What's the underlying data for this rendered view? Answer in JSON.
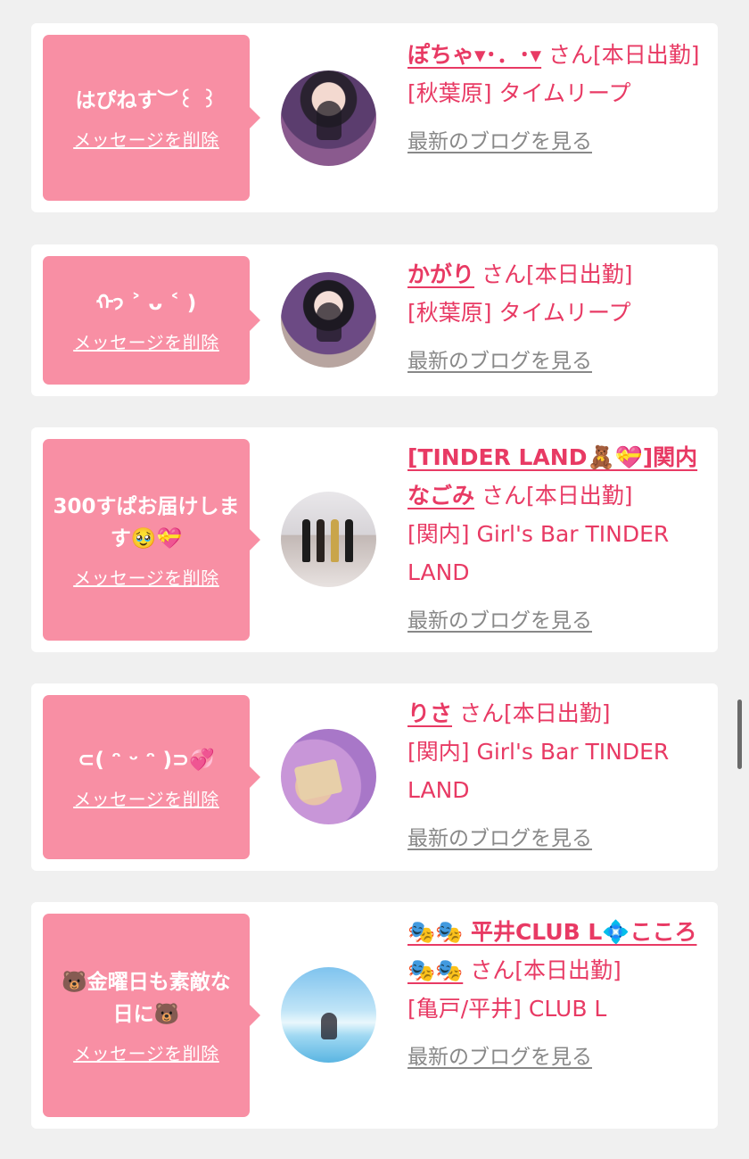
{
  "delete_label": "メッセージを削除",
  "blog_label": "最新のブログを見る",
  "cards": [
    {
      "message": "はぴねす︶꒰ ꒱",
      "name": "ぽちゃ▾･．･▾",
      "status": " さん[本日出勤]",
      "shop": "[秋葉原] タイムリープ"
    },
    {
      "message": "ᡣ𐭩 ˃ ᴗ ˂ )",
      "name": "かがり",
      "status": " さん[本日出勤]",
      "shop": "[秋葉原] タイムリープ"
    },
    {
      "message": "300すぱお届けします🥹💝",
      "name": "[TINDER LAND🧸💝]関内なごみ",
      "status": " さん[本日出勤]",
      "shop": "[関内] Girl's Bar TINDER LAND"
    },
    {
      "message": "⊂( ᵔ ᵕ ᵔ )⊃💞",
      "name": "りさ",
      "status": " さん[本日出勤]",
      "shop": "[関内] Girl's Bar TINDER LAND"
    },
    {
      "message": "🐻金曜日も素敵な日に🐻",
      "name": "🎭🎭 平井CLUB L💠こころ 🎭🎭",
      "status": " さん[本日出勤]",
      "shop": "[亀戸/平井] CLUB L"
    }
  ],
  "icons": {
    "avatar": "profile-photo",
    "scrollbar": "scroll-indicator"
  },
  "colors": {
    "accent": "#e83a64",
    "bubble": "#f88fa4",
    "muted_link": "#888888",
    "background": "#f0f0f0"
  }
}
